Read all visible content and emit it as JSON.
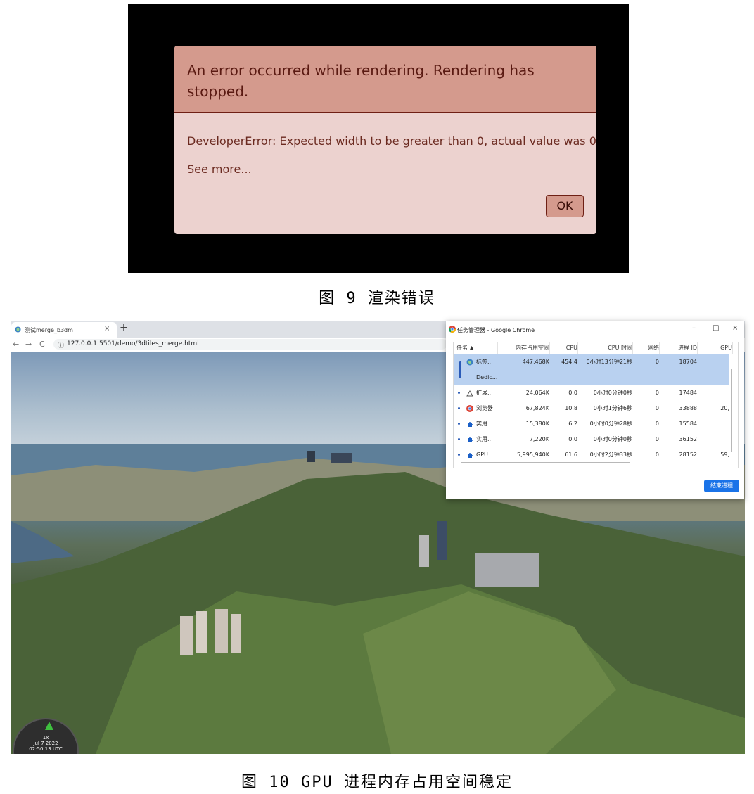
{
  "figure9": {
    "dialog": {
      "title": "An error occurred while rendering. Rendering has stopped.",
      "message": "DeveloperError: Expected width to be greater than 0, actual value was 0",
      "see_more": "See more...",
      "ok_label": "OK"
    },
    "caption": "图 9 渲染错误"
  },
  "figure10": {
    "browser": {
      "tab_title": "测试merge_b3dm",
      "tab_close": "×",
      "new_tab": "+",
      "back": "←",
      "forward": "→",
      "reload": "C",
      "info": "ⓘ",
      "url": "127.0.0.1:5501/demo/3dtiles_merge.html"
    },
    "clock": {
      "speed": "1x",
      "date": "Jul 7 2022",
      "time": "02:50:13 UTC"
    },
    "task_manager": {
      "title": "任务管理器 - Google Chrome",
      "minimize": "–",
      "maximize": "□",
      "close": "×",
      "columns": [
        "任务 ▲",
        "内存占用空间",
        "CPU",
        "CPU 时间",
        "网络",
        "进程 ID",
        "GPU"
      ],
      "rows": [
        {
          "task": "标签...",
          "task2": "Dedic...",
          "memory": "447,468K",
          "cpu": "454.4",
          "cpu_time": "0小时13分钟21秒",
          "network": "0",
          "pid": "18704",
          "gpu": "",
          "icon": "chrome-tab-icon"
        },
        {
          "task": "扩展...",
          "memory": "24,064K",
          "cpu": "0.0",
          "cpu_time": "0小时0分钟0秒",
          "network": "0",
          "pid": "17484",
          "gpu": "",
          "icon": "extension-icon"
        },
        {
          "task": "浏览器",
          "memory": "67,824K",
          "cpu": "10.8",
          "cpu_time": "0小时1分钟6秒",
          "network": "0",
          "pid": "33888",
          "gpu": "20,",
          "icon": "chrome-icon"
        },
        {
          "task": "实用...",
          "memory": "15,380K",
          "cpu": "6.2",
          "cpu_time": "0小时0分钟28秒",
          "network": "0",
          "pid": "15584",
          "gpu": "",
          "icon": "puzzle-icon"
        },
        {
          "task": "实用...",
          "memory": "7,220K",
          "cpu": "0.0",
          "cpu_time": "0小时0分钟0秒",
          "network": "0",
          "pid": "36152",
          "gpu": "",
          "icon": "puzzle-icon"
        },
        {
          "task": "GPU...",
          "memory": "5,995,940K",
          "cpu": "61.6",
          "cpu_time": "0小时2分钟33秒",
          "network": "0",
          "pid": "28152",
          "gpu": "59,",
          "icon": "puzzle-icon"
        }
      ],
      "end_process_label": "结束进程"
    },
    "caption": "图 10 GPU 进程内存占用空间稳定"
  },
  "colors": {
    "error_title_bg": "#d49a8d",
    "error_body_bg": "#ecd2cf",
    "selection": "#b9d1f0",
    "accent": "#1a73e8"
  }
}
